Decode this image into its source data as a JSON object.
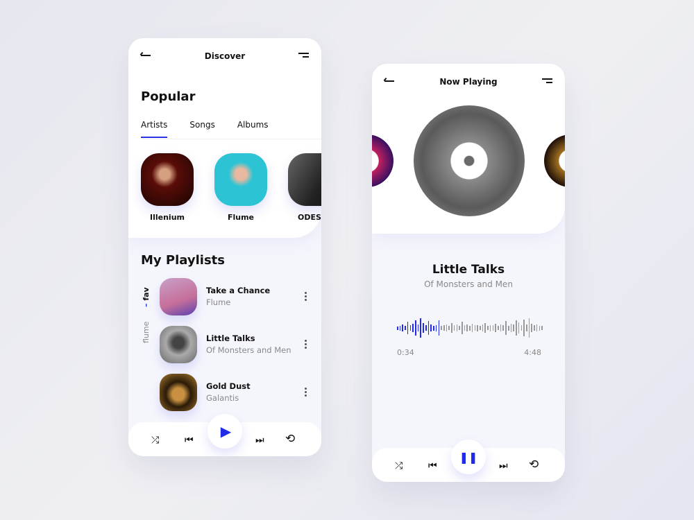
{
  "discover": {
    "title": "Discover",
    "heading": "Popular",
    "tabs": [
      {
        "label": "Artists",
        "active": true
      },
      {
        "label": "Songs"
      },
      {
        "label": "Albums"
      }
    ],
    "artists": [
      {
        "name": "Illenium"
      },
      {
        "name": "Flume"
      },
      {
        "name": "ODESZA"
      }
    ],
    "playlists_heading": "My Playlists",
    "side_labels": {
      "fav": "fav",
      "flume": "flume"
    },
    "playlists": [
      {
        "title": "Take a Chance",
        "artist": "Flume"
      },
      {
        "title": "Little Talks",
        "artist": "Of Monsters and Men"
      },
      {
        "title": "Gold Dust",
        "artist": "Galantis"
      }
    ],
    "controls": {
      "shuffle": "⤮",
      "prev": "⏮",
      "play": "▶",
      "next": "⏭",
      "repeat": "⟲"
    }
  },
  "now_playing": {
    "title": "Now Playing",
    "track": "Little Talks",
    "artist": "Of Monsters and Men",
    "elapsed": "0:34",
    "duration": "4:48",
    "waveform_progress_percent": 29,
    "controls": {
      "shuffle": "⤮",
      "prev": "⏮",
      "pause": "❚❚",
      "next": "⏭",
      "repeat": "⟲"
    }
  },
  "colors": {
    "accent": "#1f2be8",
    "background": "#f5f6fc"
  }
}
